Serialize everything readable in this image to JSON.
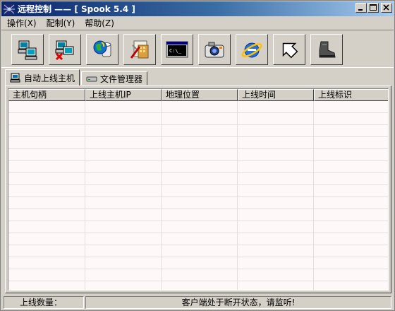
{
  "window": {
    "title": "远程控制 —— [ Spook 5.4 ]"
  },
  "menu": [
    {
      "label": "操作(X)"
    },
    {
      "label": "配制(Y)"
    },
    {
      "label": "帮助(Z)"
    }
  ],
  "toolbar": [
    {
      "icon": "connect-computer-icon"
    },
    {
      "icon": "disconnect-computer-icon"
    },
    {
      "icon": "globe-database-icon"
    },
    {
      "icon": "tools-settings-icon"
    },
    {
      "icon": "command-prompt-icon"
    },
    {
      "icon": "camera-icon"
    },
    {
      "icon": "internet-explorer-icon"
    },
    {
      "icon": "arrow-cursor-icon"
    },
    {
      "icon": "boot-icon"
    }
  ],
  "tabs": [
    {
      "label": "自动上线主机",
      "icon": "computer-icon",
      "active": true
    },
    {
      "label": "文件管理器",
      "icon": "drive-icon",
      "active": false
    }
  ],
  "table": {
    "columns": [
      "主机句柄",
      "上线主机IP",
      "地理位置",
      "上线时间",
      "上线标识"
    ],
    "rows": []
  },
  "status": {
    "online_count_label": "上线数量：",
    "message": "客户端处于断开状态，请监听!"
  },
  "colors": {
    "title_start": "#0a246a",
    "title_end": "#a6caf0",
    "face": "#d4d0c8",
    "list_bg": "#fff8f8"
  }
}
